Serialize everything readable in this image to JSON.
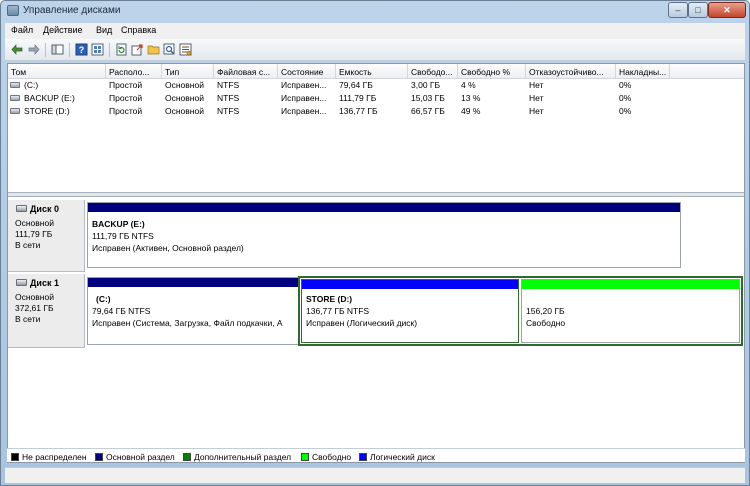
{
  "window": {
    "title": "Управление дисками",
    "min": "–",
    "max": "□",
    "close": "✕"
  },
  "menu": [
    "Файл",
    "Действие",
    "Вид",
    "Справка"
  ],
  "toolbar_icons": [
    "back-arrow-icon",
    "forward-arrow-icon",
    "show-hide-console-tree-icon",
    "help-icon",
    "properties-icon",
    "refresh-icon",
    "export-icon",
    "open-folder-icon",
    "search-icon",
    "settings-icon"
  ],
  "volumes": {
    "columns": [
      "Том",
      "Располо...",
      "Тип",
      "Файловая с...",
      "Состояние",
      "Емкость",
      "Свободо...",
      "Свободно %",
      "Отказоустойчиво...",
      "Накладны..."
    ],
    "rows": [
      [
        "(C:)",
        "Простой",
        "Основной",
        "NTFS",
        "Исправен...",
        "79,64 ГБ",
        "3,00 ГБ",
        "4 %",
        "Нет",
        "0%"
      ],
      [
        "BACKUP (E:)",
        "Простой",
        "Основной",
        "NTFS",
        "Исправен...",
        "111,79 ГБ",
        "15,03 ГБ",
        "13 %",
        "Нет",
        "0%"
      ],
      [
        "STORE (D:)",
        "Простой",
        "Основной",
        "NTFS",
        "Исправен...",
        "136,77 ГБ",
        "66,57 ГБ",
        "49 %",
        "Нет",
        "0%"
      ]
    ]
  },
  "disks": [
    {
      "name": "Диск 0",
      "type": "Основной",
      "size": "111,79 ГБ",
      "status": "В сети",
      "partitions": [
        {
          "name": "BACKUP  (E:)",
          "size": "111,79 ГБ NTFS",
          "state": "Исправен (Активен, Основной раздел)",
          "color": "#00007f"
        }
      ]
    },
    {
      "name": "Диск 1",
      "type": "Основной",
      "size": "372,61 ГБ",
      "status": "В сети",
      "partitions": [
        {
          "name": "(C:)",
          "size": "79,64 ГБ NTFS",
          "state": "Исправен (Система, Загрузка, Файл подкачки, А",
          "color": "#00007f"
        },
        {
          "name": "STORE  (D:)",
          "size": "136,77 ГБ NTFS",
          "state": "Исправен (Логический диск)",
          "color": "#0000ff"
        },
        {
          "name": "",
          "size": "156,20 ГБ",
          "state": "Свободно",
          "color": "#00ff00"
        }
      ]
    }
  ],
  "legend": [
    {
      "label": "Не распределен",
      "color": "#000000"
    },
    {
      "label": "Основной раздел",
      "color": "#00007f"
    },
    {
      "label": "Дополнительный раздел",
      "color": "#008000"
    },
    {
      "label": "Свободно",
      "color": "#00ff00"
    },
    {
      "label": "Логический диск",
      "color": "#0000ff"
    }
  ]
}
